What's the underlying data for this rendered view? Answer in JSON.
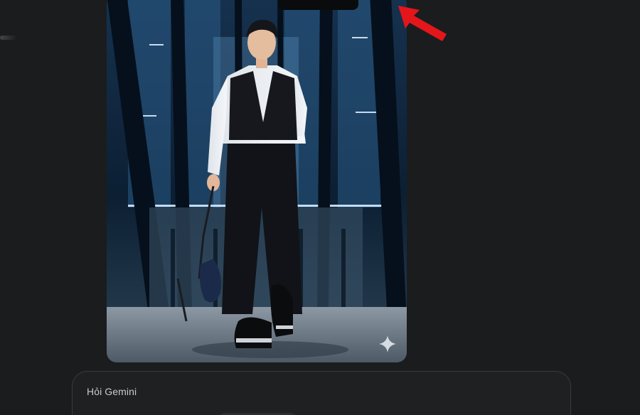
{
  "prompt": {
    "placeholder": "Hỏi Gemini"
  },
  "image": {
    "subject": "generated-image",
    "action_icon": "sparkle-icon"
  },
  "annotation": {
    "color": "#e3161c",
    "icon": "red-arrow"
  },
  "colors": {
    "background": "#1b1c1e",
    "input_border": "#3a3b3e"
  }
}
